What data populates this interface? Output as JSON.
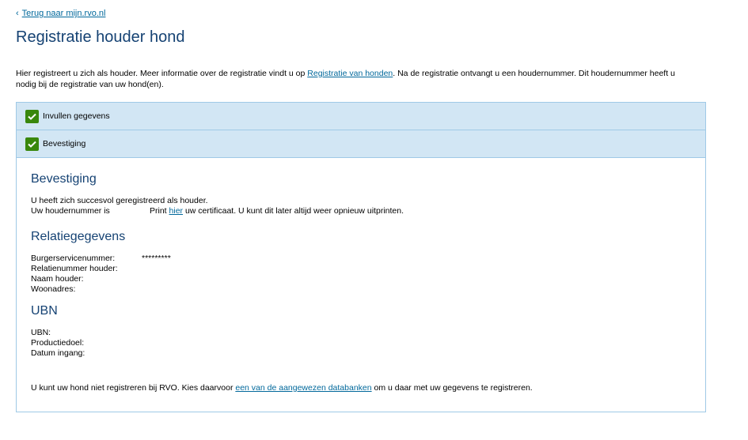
{
  "back": {
    "label": "Terug naar mijn.rvo.nl"
  },
  "page_title": "Registratie houder hond",
  "intro": {
    "text_before": "Hier registreert u zich als houder. Meer informatie over de registratie vindt u op ",
    "link": "Registratie van honden",
    "text_after": ". Na de registratie ontvangt u een houdernummer. Dit houdernummer heeft u nodig bij de registratie van uw hond(en)."
  },
  "steps": [
    {
      "label": "Invullen gegevens",
      "status": "completed"
    },
    {
      "label": "Bevestiging",
      "status": "completed"
    }
  ],
  "confirmation": {
    "heading": "Bevestiging",
    "success_text": "U heeft zich succesvol geregistreerd als houder.",
    "number_label": "Uw houdernummer is",
    "print_before": "Print ",
    "print_link": "hier",
    "print_after": " uw certificaat. U kunt dit later altijd weer opnieuw uitprinten."
  },
  "relation": {
    "heading": "Relatiegegevens",
    "fields": [
      {
        "label": "Burgerservicenummer:",
        "value": "*********"
      },
      {
        "label": "Relatienummer houder:",
        "value": ""
      },
      {
        "label": "Naam houder:",
        "value": ""
      },
      {
        "label": "Woonadres:",
        "value": ""
      }
    ]
  },
  "ubn": {
    "heading": "UBN",
    "fields": [
      {
        "label": "UBN:",
        "value": ""
      },
      {
        "label": "Productiedoel:",
        "value": ""
      },
      {
        "label": "Datum ingang:",
        "value": ""
      }
    ]
  },
  "footer_note": {
    "text_before": "U kunt uw hond niet registreren bij RVO. Kies daarvoor ",
    "link": "een van de aangewezen databanken",
    "text_after": " om u daar met uw gegevens te registreren."
  },
  "colors": {
    "title": "#154273",
    "link": "#01689b",
    "step_bg": "#d2e6f4",
    "border": "#9fc9e6",
    "check": "#39870c"
  }
}
